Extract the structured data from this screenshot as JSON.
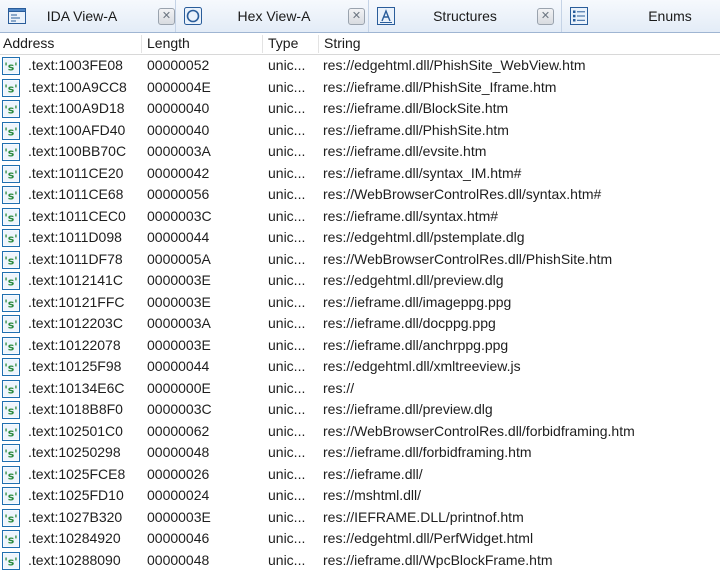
{
  "tabs": [
    {
      "label": "IDA View-A",
      "icon": "ida-view-icon",
      "closable": true
    },
    {
      "label": "Hex View-A",
      "icon": "hex-view-icon",
      "closable": true
    },
    {
      "label": "Structures",
      "icon": "structures-icon",
      "closable": true
    },
    {
      "label": "Enums",
      "icon": "enums-icon",
      "closable": false
    }
  ],
  "columns": {
    "address": "Address",
    "length": "Length",
    "type": "Type",
    "string": "String"
  },
  "rows": [
    {
      "address": ".text:1003FE08",
      "length": "00000052",
      "type": "unic...",
      "string": "res://edgehtml.dll/PhishSite_WebView.htm"
    },
    {
      "address": ".text:100A9CC8",
      "length": "0000004E",
      "type": "unic...",
      "string": "res://ieframe.dll/PhishSite_Iframe.htm"
    },
    {
      "address": ".text:100A9D18",
      "length": "00000040",
      "type": "unic...",
      "string": "res://ieframe.dll/BlockSite.htm"
    },
    {
      "address": ".text:100AFD40",
      "length": "00000040",
      "type": "unic...",
      "string": "res://ieframe.dll/PhishSite.htm"
    },
    {
      "address": ".text:100BB70C",
      "length": "0000003A",
      "type": "unic...",
      "string": "res://ieframe.dll/evsite.htm"
    },
    {
      "address": ".text:1011CE20",
      "length": "00000042",
      "type": "unic...",
      "string": "res://ieframe.dll/syntax_IM.htm#"
    },
    {
      "address": ".text:1011CE68",
      "length": "00000056",
      "type": "unic...",
      "string": "res://WebBrowserControlRes.dll/syntax.htm#"
    },
    {
      "address": ".text:1011CEC0",
      "length": "0000003C",
      "type": "unic...",
      "string": "res://ieframe.dll/syntax.htm#"
    },
    {
      "address": ".text:1011D098",
      "length": "00000044",
      "type": "unic...",
      "string": "res://edgehtml.dll/pstemplate.dlg"
    },
    {
      "address": ".text:1011DF78",
      "length": "0000005A",
      "type": "unic...",
      "string": "res://WebBrowserControlRes.dll/PhishSite.htm"
    },
    {
      "address": ".text:1012141C",
      "length": "0000003E",
      "type": "unic...",
      "string": "res://edgehtml.dll/preview.dlg"
    },
    {
      "address": ".text:10121FFC",
      "length": "0000003E",
      "type": "unic...",
      "string": "res://ieframe.dll/imageppg.ppg"
    },
    {
      "address": ".text:1012203C",
      "length": "0000003A",
      "type": "unic...",
      "string": "res://ieframe.dll/docppg.ppg"
    },
    {
      "address": ".text:10122078",
      "length": "0000003E",
      "type": "unic...",
      "string": "res://ieframe.dll/anchrppg.ppg"
    },
    {
      "address": ".text:10125F98",
      "length": "00000044",
      "type": "unic...",
      "string": "res://edgehtml.dll/xmltreeview.js"
    },
    {
      "address": ".text:10134E6C",
      "length": "0000000E",
      "type": "unic...",
      "string": "res://"
    },
    {
      "address": ".text:1018B8F0",
      "length": "0000003C",
      "type": "unic...",
      "string": "res://ieframe.dll/preview.dlg"
    },
    {
      "address": ".text:102501C0",
      "length": "00000062",
      "type": "unic...",
      "string": "res://WebBrowserControlRes.dll/forbidframing.htm"
    },
    {
      "address": ".text:10250298",
      "length": "00000048",
      "type": "unic...",
      "string": "res://ieframe.dll/forbidframing.htm"
    },
    {
      "address": ".text:1025FCE8",
      "length": "00000026",
      "type": "unic...",
      "string": "res://ieframe.dll/"
    },
    {
      "address": ".text:1025FD10",
      "length": "00000024",
      "type": "unic...",
      "string": "res://mshtml.dll/"
    },
    {
      "address": ".text:1027B320",
      "length": "0000003E",
      "type": "unic...",
      "string": "res://IEFRAME.DLL/printnof.htm"
    },
    {
      "address": ".text:10284920",
      "length": "00000046",
      "type": "unic...",
      "string": "res://edgehtml.dll/PerfWidget.html"
    },
    {
      "address": ".text:10288090",
      "length": "00000048",
      "type": "unic...",
      "string": "res://ieframe.dll/WpcBlockFrame.htm"
    }
  ],
  "row_icon": "string-item-icon",
  "colors": {
    "tabbar_top": "#f6f9fd",
    "tabbar_bottom": "#e3ecf7",
    "icon_border": "#1f6fb0",
    "icon_green": "#2b8a3e"
  }
}
